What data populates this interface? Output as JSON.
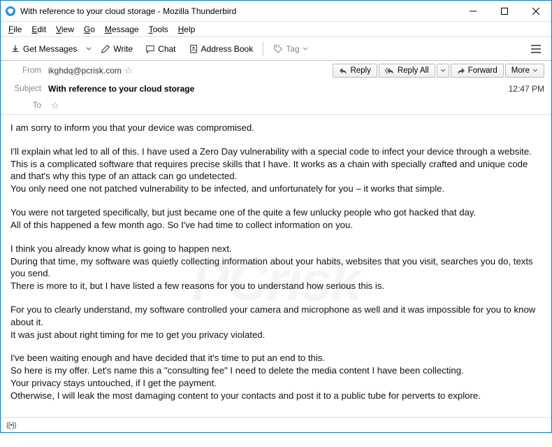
{
  "window": {
    "title": "With reference to your cloud storage - Mozilla Thunderbird"
  },
  "menubar": {
    "items": [
      "File",
      "Edit",
      "View",
      "Go",
      "Message",
      "Tools",
      "Help"
    ]
  },
  "toolbar": {
    "get_messages": "Get Messages",
    "write": "Write",
    "chat": "Chat",
    "address_book": "Address Book",
    "tag": "Tag"
  },
  "header": {
    "from_label": "From",
    "from_value": "ikghdq@pcrisk.com",
    "subject_label": "Subject",
    "subject_value": "With reference to your cloud storage",
    "to_label": "To",
    "time": "12:47 PM",
    "actions": {
      "reply": "Reply",
      "reply_all": "Reply All",
      "forward": "Forward",
      "more": "More"
    }
  },
  "body": {
    "p1": "I am sorry to inform you that your device was compromised.",
    "p2": "I'll explain what led to all of this. I have used a Zero Day vulnerability with a special code to infect your device through a website.\nThis is a complicated software that requires precise skills that I have. It works as a chain with specially crafted and unique code and that's why this type of an attack can go undetected.\nYou only need one not patched vulnerability to be infected, and unfortunately for you – it works that simple.",
    "p3": "You were not targeted specifically, but just became one of the quite a few unlucky people who got hacked that day.\nAll of this happened a few month ago. So I've had time to collect information on you.",
    "p4": "I think you already know what is going to happen next.\nDuring that time, my software was quietly collecting information about your habits, websites that you visit, searches you do, texts you send.\nThere is more to it, but I have listed a few reasons for you to understand how serious this is.",
    "p5": "For you to clearly understand, my software controlled your camera and microphone as well and it was impossible for you to know about it.\nIt was just about right timing for me to get you privacy violated.",
    "p6": "I've been waiting enough and have decided that it's time to put an end to this.\nSo here is my offer. Let's name this a \"consulting fee\" I need to delete the media content I have been collecting.\nYour privacy stays untouched, if I get the payment.\nOtherwise, I will leak the most damaging content to your contacts and post it to a public tube for perverts to explore."
  }
}
